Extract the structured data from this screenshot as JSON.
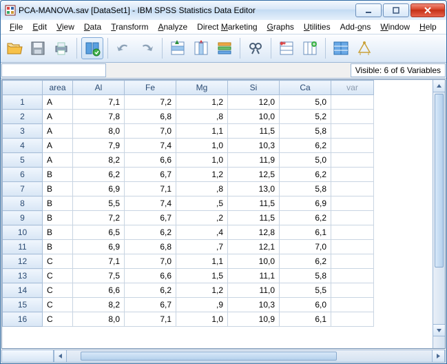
{
  "title": "PCA-MANOVA.sav [DataSet1] - IBM SPSS Statistics Data Editor",
  "menu": {
    "file": "File",
    "edit": "Edit",
    "view": "View",
    "data": "Data",
    "transform": "Transform",
    "analyze": "Analyze",
    "direct": "Direct Marketing",
    "graphs": "Graphs",
    "utilities": "Utilities",
    "addons": "Add-ons",
    "window": "Window",
    "help": "Help"
  },
  "toolbar_icons": [
    "open",
    "save",
    "print",
    "recall",
    "undo",
    "redo",
    "goto-case",
    "goto-var",
    "variables",
    "find",
    "insert-case",
    "insert-var",
    "split",
    "weight"
  ],
  "visible_text": "Visible: 6 of 6 Variables",
  "columns": [
    "area",
    "Al",
    "Fe",
    "Mg",
    "Si",
    "Ca"
  ],
  "var_placeholder": "var",
  "chart_data": {
    "type": "table",
    "columns": [
      "area",
      "Al",
      "Fe",
      "Mg",
      "Si",
      "Ca"
    ],
    "rows": [
      {
        "n": 1,
        "area": "A",
        "Al": "7,1",
        "Fe": "7,2",
        "Mg": "1,2",
        "Si": "12,0",
        "Ca": "5,0"
      },
      {
        "n": 2,
        "area": "A",
        "Al": "7,8",
        "Fe": "6,8",
        "Mg": ",8",
        "Si": "10,0",
        "Ca": "5,2"
      },
      {
        "n": 3,
        "area": "A",
        "Al": "8,0",
        "Fe": "7,0",
        "Mg": "1,1",
        "Si": "11,5",
        "Ca": "5,8"
      },
      {
        "n": 4,
        "area": "A",
        "Al": "7,9",
        "Fe": "7,4",
        "Mg": "1,0",
        "Si": "10,3",
        "Ca": "6,2"
      },
      {
        "n": 5,
        "area": "A",
        "Al": "8,2",
        "Fe": "6,6",
        "Mg": "1,0",
        "Si": "11,9",
        "Ca": "5,0"
      },
      {
        "n": 6,
        "area": "B",
        "Al": "6,2",
        "Fe": "6,7",
        "Mg": "1,2",
        "Si": "12,5",
        "Ca": "6,2"
      },
      {
        "n": 7,
        "area": "B",
        "Al": "6,9",
        "Fe": "7,1",
        "Mg": ",8",
        "Si": "13,0",
        "Ca": "5,8"
      },
      {
        "n": 8,
        "area": "B",
        "Al": "5,5",
        "Fe": "7,4",
        "Mg": ",5",
        "Si": "11,5",
        "Ca": "6,9"
      },
      {
        "n": 9,
        "area": "B",
        "Al": "7,2",
        "Fe": "6,7",
        "Mg": ",2",
        "Si": "11,5",
        "Ca": "6,2"
      },
      {
        "n": 10,
        "area": "B",
        "Al": "6,5",
        "Fe": "6,2",
        "Mg": ",4",
        "Si": "12,8",
        "Ca": "6,1"
      },
      {
        "n": 11,
        "area": "B",
        "Al": "6,9",
        "Fe": "6,8",
        "Mg": ",7",
        "Si": "12,1",
        "Ca": "7,0"
      },
      {
        "n": 12,
        "area": "C",
        "Al": "7,1",
        "Fe": "7,0",
        "Mg": "1,1",
        "Si": "10,0",
        "Ca": "6,2"
      },
      {
        "n": 13,
        "area": "C",
        "Al": "7,5",
        "Fe": "6,6",
        "Mg": "1,5",
        "Si": "11,1",
        "Ca": "5,8"
      },
      {
        "n": 14,
        "area": "C",
        "Al": "6,6",
        "Fe": "6,2",
        "Mg": "1,2",
        "Si": "11,0",
        "Ca": "5,5"
      },
      {
        "n": 15,
        "area": "C",
        "Al": "8,2",
        "Fe": "6,7",
        "Mg": ",9",
        "Si": "10,3",
        "Ca": "6,0"
      },
      {
        "n": 16,
        "area": "C",
        "Al": "8,0",
        "Fe": "7,1",
        "Mg": "1,0",
        "Si": "10,9",
        "Ca": "6,1"
      }
    ]
  }
}
